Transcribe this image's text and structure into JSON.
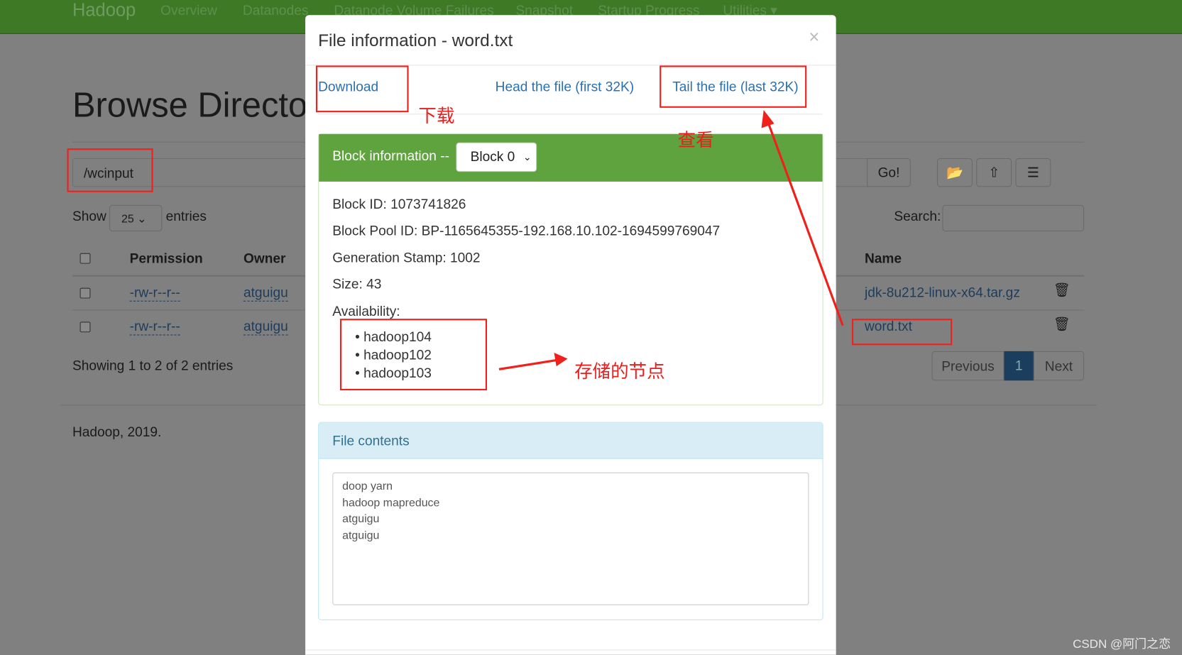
{
  "navbar": {
    "brand": "Hadoop",
    "items": [
      "Overview",
      "Datanodes",
      "Datanode Volume Failures",
      "Snapshot",
      "Startup Progress",
      "Utilities ▾"
    ]
  },
  "page": {
    "title": "Browse Directory",
    "path": "/wcinput",
    "go": "Go!",
    "show": "Show",
    "entries_value": "25",
    "entries": "entries",
    "search": "Search:",
    "columns": [
      "Permission",
      "Owner",
      "Name"
    ],
    "rows": [
      {
        "permission": "-rw-r--r--",
        "owner": "atguigu",
        "name": "jdk-8u212-linux-x64.tar.gz"
      },
      {
        "permission": "-rw-r--r--",
        "owner": "atguigu",
        "name": "word.txt"
      }
    ],
    "showing": "Showing 1 to 2 of 2 entries",
    "pagination": {
      "previous": "Previous",
      "current": "1",
      "next": "Next"
    },
    "footer": "Hadoop, 2019."
  },
  "modal": {
    "title": "File information - word.txt",
    "close": "×",
    "download": "Download",
    "head": "Head the file (first 32K)",
    "tail": "Tail the file (last 32K)",
    "block_label": "Block information --",
    "block_select": "Block 0",
    "block_id": "Block ID: 1073741826",
    "block_pool": "Block Pool ID: BP-1165645355-192.168.10.102-1694599769047",
    "gen_stamp": "Generation Stamp: 1002",
    "size": "Size: 43",
    "availability": "Availability:",
    "nodes": [
      "hadoop104",
      "hadoop102",
      "hadoop103"
    ],
    "file_contents_label": "File contents",
    "file_contents": "doop yarn\nhadoop mapreduce\natguigu\natguigu"
  },
  "annotations": {
    "download": "下载",
    "view": "查看",
    "nodes": "存储的节点"
  },
  "watermark": "CSDN @阿门之恋",
  "colors": {
    "block_header": "#5fa33e",
    "annotation": "#ee1c1c",
    "page_active": "#1c3e5e"
  }
}
